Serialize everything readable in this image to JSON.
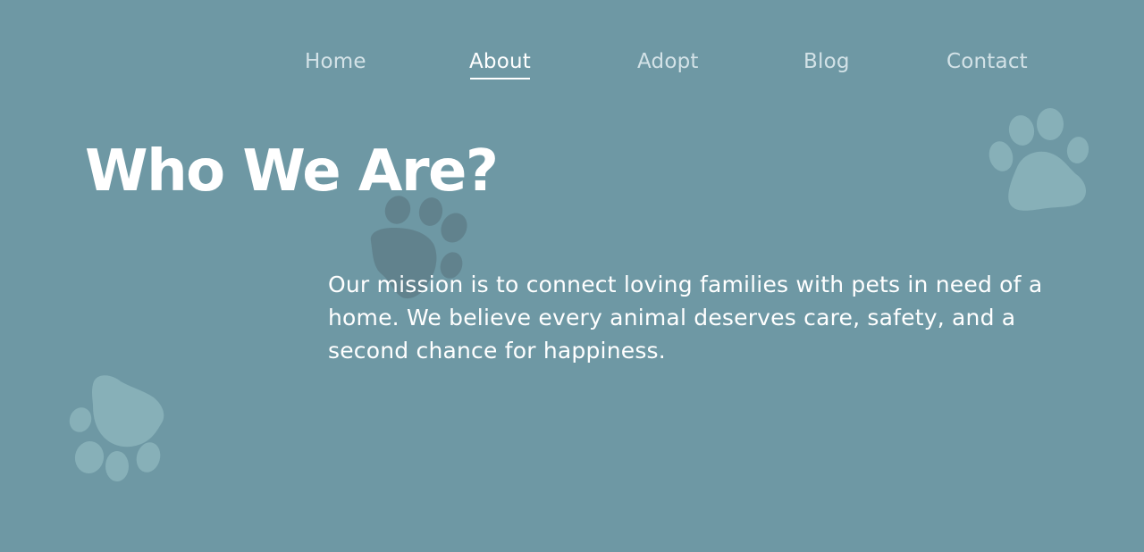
{
  "nav": {
    "items": [
      {
        "label": "Home",
        "active": false
      },
      {
        "label": "About",
        "active": true
      },
      {
        "label": "Adopt",
        "active": false
      },
      {
        "label": "Blog",
        "active": false
      },
      {
        "label": "Contact",
        "active": false
      }
    ]
  },
  "hero": {
    "title": "Who We Are?",
    "mission": "Our mission is to connect loving families with pets in need of a home. We believe every animal deserves care, safety, and a second chance for happiness."
  },
  "colors": {
    "background": "#6e98a4",
    "paw_light": "#87b0b8",
    "paw_dark": "#5f7f8a",
    "nav_text": "#d3e2e7",
    "text": "#ffffff"
  },
  "icons": [
    "paw-print-icon"
  ]
}
